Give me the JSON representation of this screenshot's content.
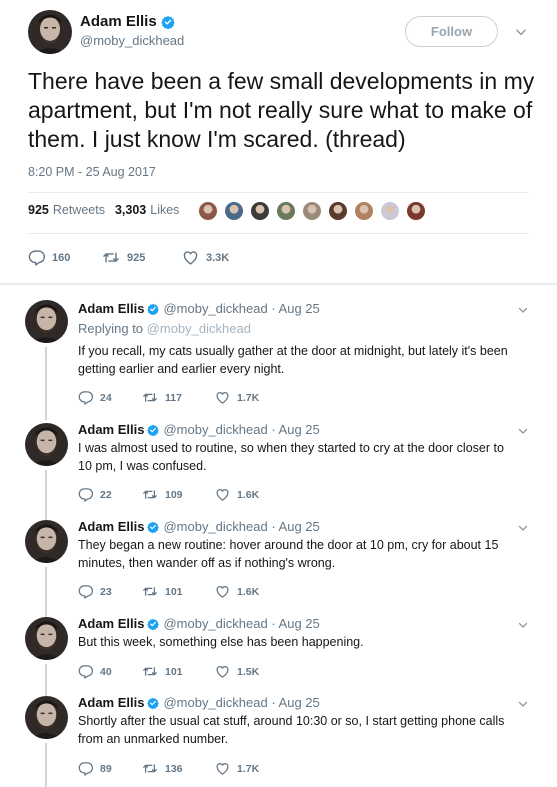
{
  "main_tweet": {
    "author_name": "Adam Ellis",
    "author_handle": "@moby_dickhead",
    "follow_label": "Follow",
    "text": "There have been a few small developments in my apartment, but I'm not really sure what to make of them. I just know I'm scared. (thread)",
    "timestamp": "8:20 PM - 25 Aug 2017",
    "retweets_count": "925",
    "retweets_label": "Retweets",
    "likes_count": "3,303",
    "likes_label": "Likes",
    "reply_count": "160",
    "retweet_action_count": "925",
    "like_action_count": "3.3K",
    "liker_colors": [
      "#8a5a44",
      "#4a6a8a",
      "#3a3a3a",
      "#6a7a5a",
      "#9a8a7a",
      "#5a3a2a",
      "#b08060",
      "#c9c9d9",
      "#7a3a2a"
    ]
  },
  "replies": [
    {
      "name": "Adam Ellis",
      "handle": "@moby_dickhead · Aug 25",
      "replying_prefix": "Replying to",
      "replying_handle": "@moby_dickhead",
      "text": "If you recall, my cats usually gather at the door at midnight, but lately it's been getting earlier and earlier every night.",
      "replies": "24",
      "retweets": "117",
      "likes": "1.7K"
    },
    {
      "name": "Adam Ellis",
      "handle": "@moby_dickhead · Aug 25",
      "text": "I was almost used to routine, so when they started to cry at the door closer to 10 pm, I was confused.",
      "replies": "22",
      "retweets": "109",
      "likes": "1.6K"
    },
    {
      "name": "Adam Ellis",
      "handle": "@moby_dickhead · Aug 25",
      "text": "They began a new routine: hover around the door at 10 pm, cry for about 15 minutes, then wander off as if nothing's wrong.",
      "replies": "23",
      "retweets": "101",
      "likes": "1.6K"
    },
    {
      "name": "Adam Ellis",
      "handle": "@moby_dickhead · Aug 25",
      "text": "But this week, something else has been happening.",
      "replies": "40",
      "retweets": "101",
      "likes": "1.5K"
    },
    {
      "name": "Adam Ellis",
      "handle": "@moby_dickhead · Aug 25",
      "text": "Shortly after the usual cat stuff, around 10:30 or so, I start getting phone calls from an unmarked number.",
      "replies": "89",
      "retweets": "136",
      "likes": "1.7K"
    }
  ],
  "colors": {
    "verified_blue": "#1da1f2",
    "secondary_text": "#657786",
    "thread_line": "#ccd6dd"
  },
  "icons": [
    "verified-badge-icon",
    "chevron-down-icon",
    "reply-icon",
    "retweet-icon",
    "like-heart-icon"
  ]
}
